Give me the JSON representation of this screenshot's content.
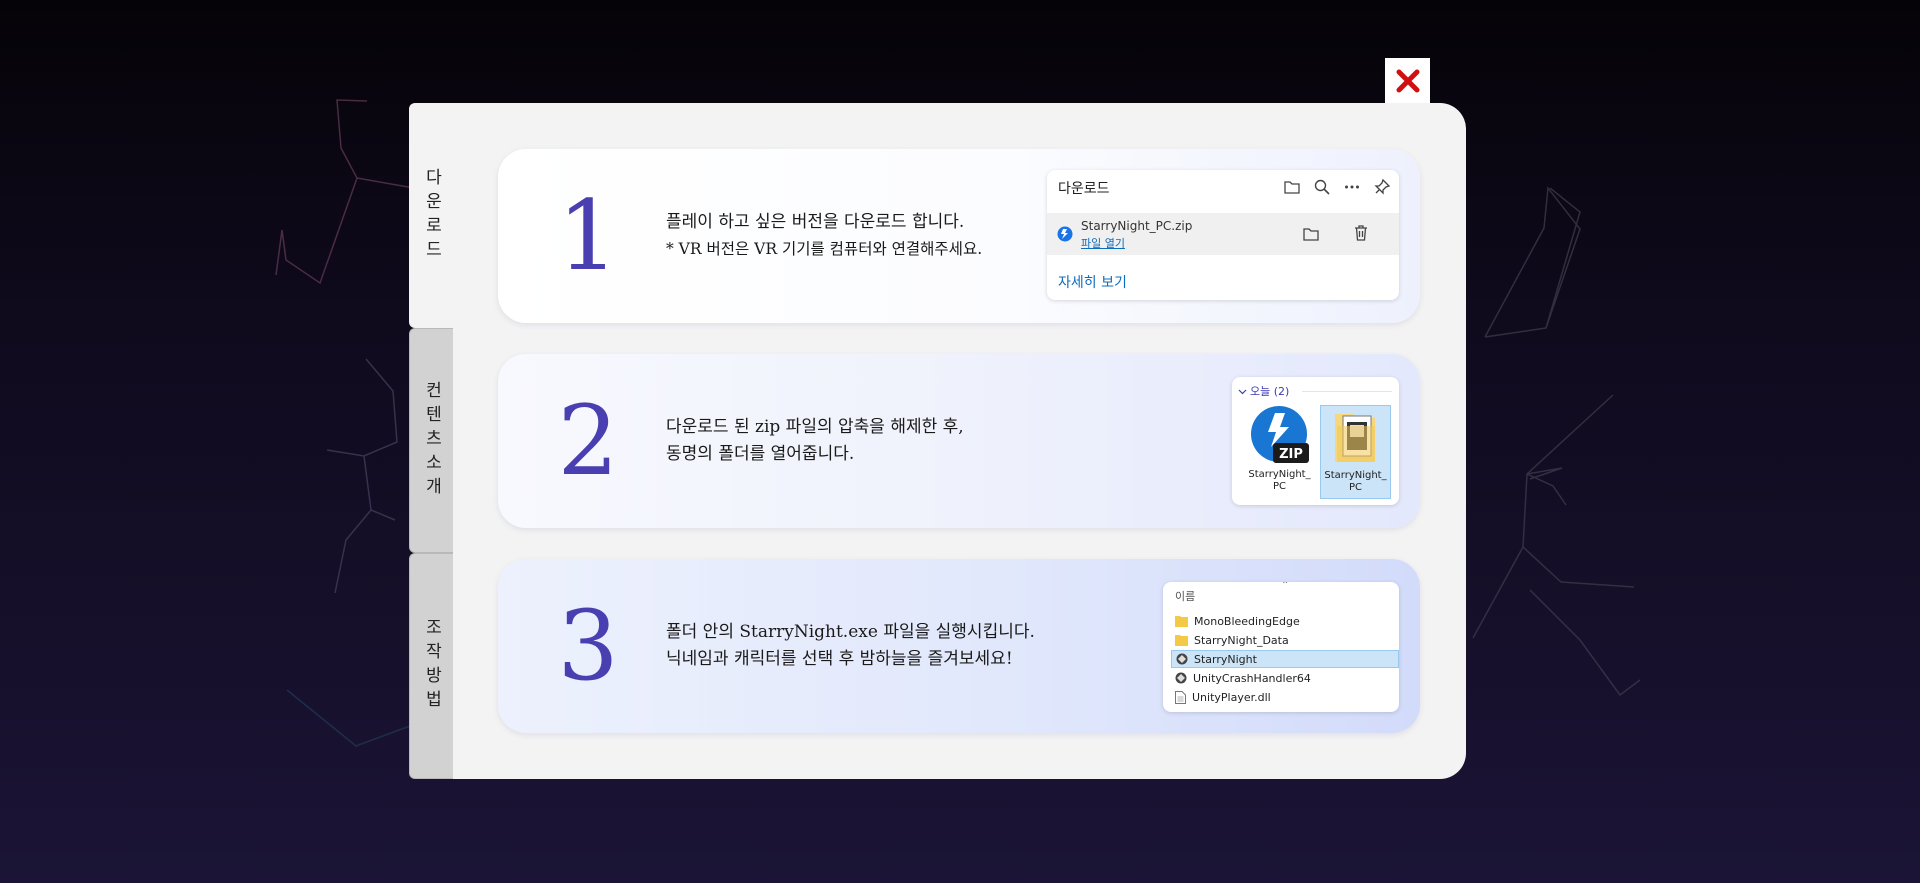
{
  "close_label": "✕",
  "tabs": [
    {
      "label": "다운로드"
    },
    {
      "label": "컨텐츠소개"
    },
    {
      "label": "조작방법"
    }
  ],
  "steps": [
    {
      "number": "1",
      "lines": [
        "플레이 하고 싶은 버전을 다운로드 합니다.",
        "* VR 버전은 VR 기기를 컴퓨터와 연결해주세요."
      ]
    },
    {
      "number": "2",
      "lines": [
        "다운로드 된 zip 파일의 압축을 해제한 후,",
        "동명의 폴더를 열어줍니다."
      ]
    },
    {
      "number": "3",
      "lines": [
        "폴더 안의 StarryNight.exe 파일을 실행시킵니다.",
        "닉네임과 캐릭터를 선택 후 밤하늘을 즐겨보세요!"
      ]
    }
  ],
  "download_panel": {
    "title": "다운로드",
    "filename": "StarryNight_PC.zip",
    "open_file": "파일 열기",
    "see_more": "자세히 보기"
  },
  "explorer": {
    "group": "오늘 (2)",
    "items": [
      {
        "label": "StarryNight_ PC",
        "icon": "zip-icon",
        "badge": "ZIP"
      },
      {
        "label": "StarryNight_ PC",
        "icon": "folder-icon"
      }
    ]
  },
  "file_list": {
    "header": "이름",
    "rows": [
      {
        "name": "MonoBleedingEdge",
        "icon": "folder-icon"
      },
      {
        "name": "StarryNight_Data",
        "icon": "folder-icon"
      },
      {
        "name": "StarryNight",
        "icon": "app-icon",
        "selected": true
      },
      {
        "name": "UnityCrashHandler64",
        "icon": "app-icon"
      },
      {
        "name": "UnityPlayer.dll",
        "icon": "file-icon"
      }
    ]
  },
  "colors": {
    "accent": "#4a3fb0",
    "close_red": "#d01010",
    "link_blue": "#0f6cbd",
    "selection": "#cce4f7"
  }
}
